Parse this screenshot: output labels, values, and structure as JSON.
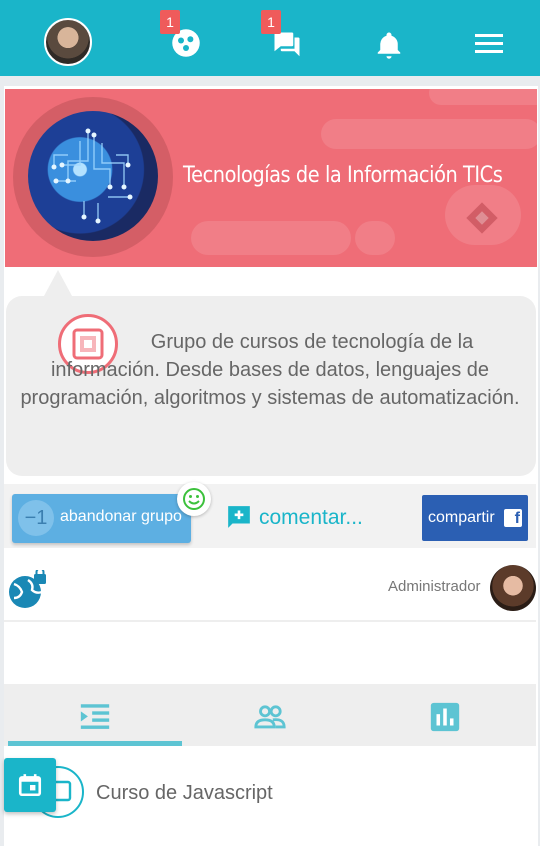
{
  "nav": {
    "groups_badge": "1",
    "messages_badge": "1"
  },
  "group": {
    "title": "Tecnologías de la Información TICs",
    "description_line1": "Grupo de cursos de tecnología de la",
    "description_rest": "información. Desde bases de datos, lenguajes de programación, algoritmos y sistemas de automatización."
  },
  "actions": {
    "leave_count": "−1",
    "leave_label": "abandonar grupo",
    "comment_label": "comentar...",
    "share_label": "compartir",
    "share_fb": "f"
  },
  "admin": {
    "label": "Administrador"
  },
  "tabs": [
    {
      "icon": "list-indent-icon",
      "active": true
    },
    {
      "icon": "people-icon",
      "active": false
    },
    {
      "icon": "bar-chart-icon",
      "active": false
    }
  ],
  "course": {
    "title": "Curso de Javascript"
  },
  "colors": {
    "primary": "#1ab5c9",
    "hero": "#ef6d77",
    "badge": "#ef5b5b",
    "leave": "#5dafe2",
    "share": "#2b5fb3"
  }
}
